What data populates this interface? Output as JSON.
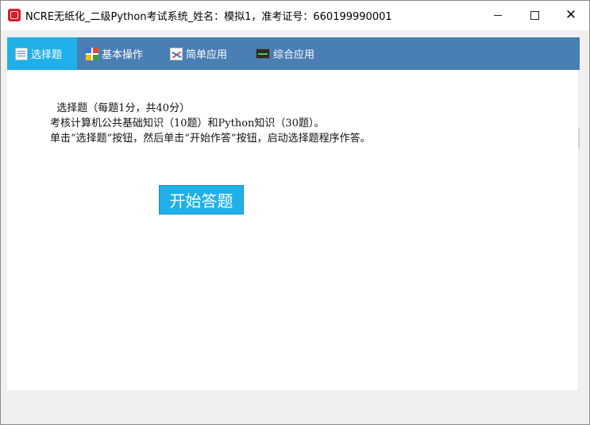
{
  "window": {
    "title": "NCRE无纸化_二级Python考试系统_姓名：模拟1，准考证号：660199990001"
  },
  "tabs": [
    {
      "label": "选择题",
      "icon": "list-icon",
      "active": true
    },
    {
      "label": "基本操作",
      "icon": "grid-icon",
      "active": false
    },
    {
      "label": "简单应用",
      "icon": "chart-icon",
      "active": false
    },
    {
      "label": "综合应用",
      "icon": "monitor-icon",
      "active": false
    }
  ],
  "content": {
    "lines": [
      "  选择题（每题1分，共40分）",
      "考核计算机公共基础知识（10题）和Python知识（30题）。",
      "单击“选择题”按钮，然后单击“开始作答”按钮，启动选择题程序作答。"
    ],
    "start_button": "开始答题"
  },
  "colors": {
    "tabbar": "#4a7fb5",
    "active_tab": "#1fb0ea",
    "start_button": "#1fb0ea"
  }
}
